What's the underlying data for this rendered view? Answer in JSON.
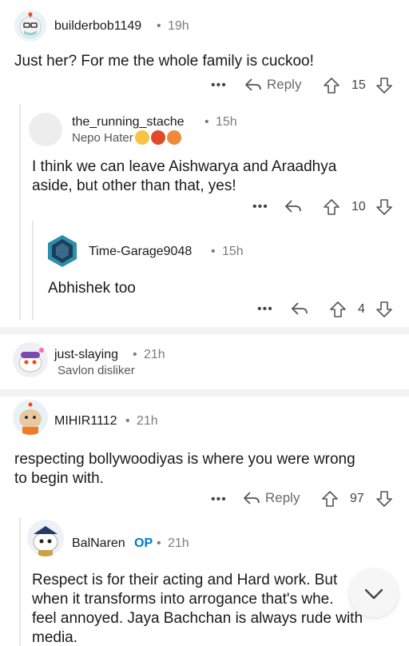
{
  "comments": [
    {
      "user": "builderbob1149",
      "time": "19h",
      "body": "Just her? For me the whole family is cuckoo!",
      "reply_label": "Reply",
      "votes": "15"
    },
    {
      "user": "the_running_stache",
      "time": "15h",
      "flair": "Nepo Hater",
      "body_line1": "I think we can leave Aishwarya and Araadhya",
      "body_line2": "aside, but other than that, yes!",
      "votes": "10"
    },
    {
      "user": "Time-Garage9048",
      "time": "15h",
      "body": "Abhishek too",
      "votes": "4"
    },
    {
      "user": "just-slaying",
      "time": "21h",
      "flair": "Savlon disliker"
    },
    {
      "user": "MIHIR1112",
      "time": "21h",
      "body_line1": "respecting bollywoodiyas is where you were wrong",
      "body_line2": "to begin with.",
      "reply_label": "Reply",
      "votes": "97"
    },
    {
      "user": "BalNaren",
      "op_label": "OP",
      "time": "21h",
      "body_line1": "Respect is for their acting and Hard work. But",
      "body_line2": "when it transforms into arrogance that's whe.",
      "body_line3": "feel annoyed. Jaya Bachchan is always rude with",
      "body_line4": "media."
    }
  ],
  "separator": "•",
  "more_glyph": "•••",
  "colors": {
    "accent": "#0079d3",
    "divider": "#f2f2f2",
    "thread_line": "#e6e6e6"
  }
}
